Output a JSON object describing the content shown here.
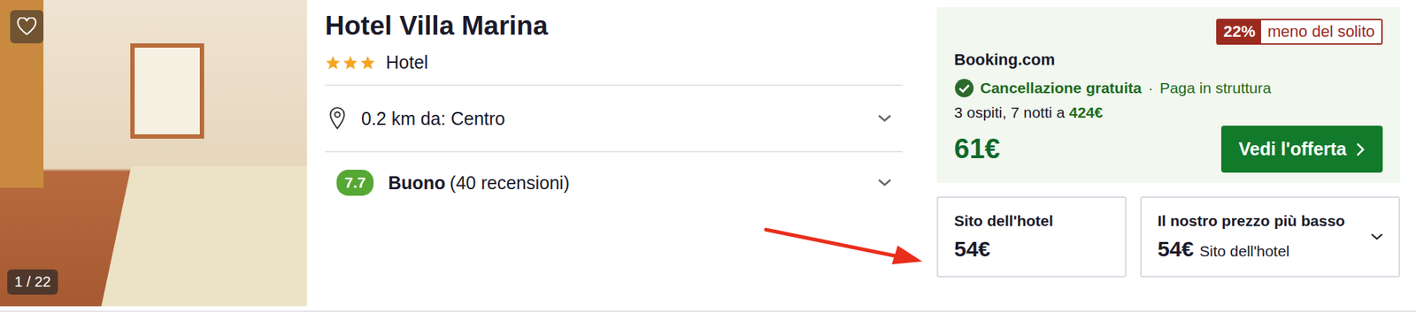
{
  "hotel": {
    "name": "Hotel Villa Marina",
    "stars": 3,
    "type": "Hotel",
    "favorite": false
  },
  "photo": {
    "counter": "1 / 22"
  },
  "details": [
    {
      "kind": "location",
      "text": "0.2 km da: Centro",
      "expanded": false
    },
    {
      "kind": "rating",
      "score": "7.7",
      "label": "Buono",
      "reviews": "(40 recensioni)",
      "expanded": false
    }
  ],
  "offer": {
    "badge_value": "22%",
    "badge_text": "meno del solito",
    "provider": "Booking.com",
    "cancellation": "Cancellazione gratuita",
    "separator": "·",
    "payment": "Paga in struttura",
    "stay_prefix": "3 ospiti, 7 notti a",
    "stay_total": "424€",
    "price": "61€",
    "button": "Vedi l'offerta"
  },
  "alternatives": [
    {
      "title": "Sito dell'hotel",
      "price": "54€",
      "expandable": false
    },
    {
      "title": "Il nostro prezzo più basso",
      "price": "54€",
      "source": "Sito dell'hotel",
      "expandable": true
    }
  ]
}
